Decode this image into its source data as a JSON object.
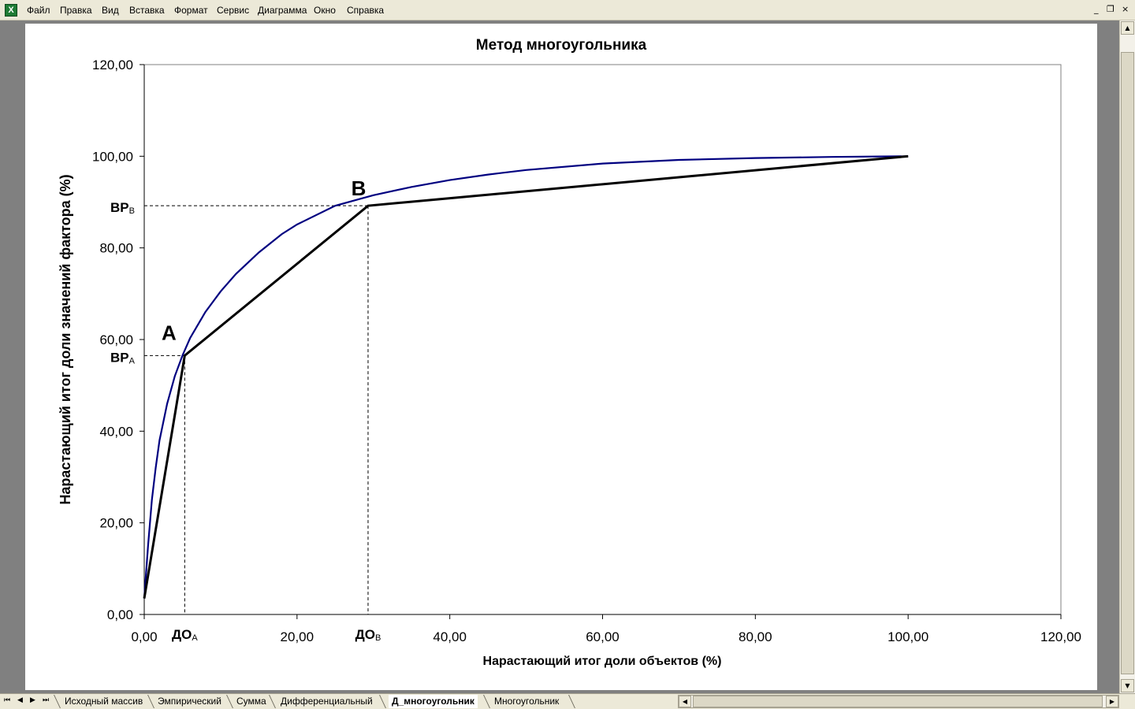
{
  "menu": {
    "app_icon_label": "X",
    "items": [
      "Файл",
      "Правка",
      "Вид",
      "Вставка",
      "Формат",
      "Сервис",
      "Диаграмма",
      "Окно",
      "Справка"
    ],
    "window_controls": [
      "_",
      "❐",
      "×"
    ]
  },
  "sheets": {
    "nav": [
      "⏮",
      "◀",
      "▶",
      "⏭"
    ],
    "tabs": [
      "Исходный массив",
      "Эмпирический",
      "Сумма",
      "Дифференциальный",
      "Д_многоугольник",
      "Многоугольник"
    ],
    "active_index": 4
  },
  "scrollbar": {
    "up": "▲",
    "down": "▼",
    "left": "◀",
    "right": "▶"
  },
  "colors": {
    "curve": "#000080",
    "polygon": "#000000",
    "plot_border": "#808080",
    "background": "#ffffff"
  },
  "chart_data": {
    "type": "line",
    "title": "Метод многоугольника",
    "xlabel": "Нарастающий итог доли объектов (%)",
    "ylabel": "Нарастающий итог доли значений фактора (%)",
    "xlim": [
      0,
      120
    ],
    "ylim": [
      0,
      120
    ],
    "x_ticks": [
      "0,00",
      "20,00",
      "40,00",
      "60,00",
      "80,00",
      "100,00",
      "120,00"
    ],
    "y_ticks": [
      "0,00",
      "20,00",
      "40,00",
      "60,00",
      "80,00",
      "100,00",
      "120,00"
    ],
    "grid": false,
    "curve": {
      "x": [
        0,
        0.5,
        1,
        1.5,
        2,
        3,
        4,
        5,
        6,
        8,
        10,
        12,
        15,
        18,
        20,
        25,
        30,
        35,
        40,
        45,
        50,
        60,
        70,
        80,
        90,
        100
      ],
      "y": [
        3.5,
        15,
        25,
        32,
        38,
        46,
        52,
        56.5,
        60.3,
        66,
        70.5,
        74.3,
        79,
        83,
        85.1,
        89.2,
        91.5,
        93.3,
        94.8,
        96,
        97,
        98.4,
        99.2,
        99.6,
        99.85,
        100
      ]
    },
    "polygon": {
      "x": [
        0,
        5.3,
        29.3,
        100
      ],
      "y": [
        3.5,
        56.5,
        89.2,
        100
      ]
    },
    "points": [
      {
        "label": "A",
        "x": 5.3,
        "y": 56.5
      },
      {
        "label": "B",
        "x": 29.3,
        "y": 89.2
      }
    ],
    "annotations": {
      "y_marks": [
        {
          "main": "ВР",
          "sub": "A",
          "y": 56.5
        },
        {
          "main": "ВР",
          "sub": "В",
          "y": 89.2
        }
      ],
      "x_marks": [
        {
          "main": "ДО",
          "sub": "A",
          "x": 5.3
        },
        {
          "main": "ДО",
          "sub": "В",
          "x": 29.3
        }
      ]
    }
  }
}
